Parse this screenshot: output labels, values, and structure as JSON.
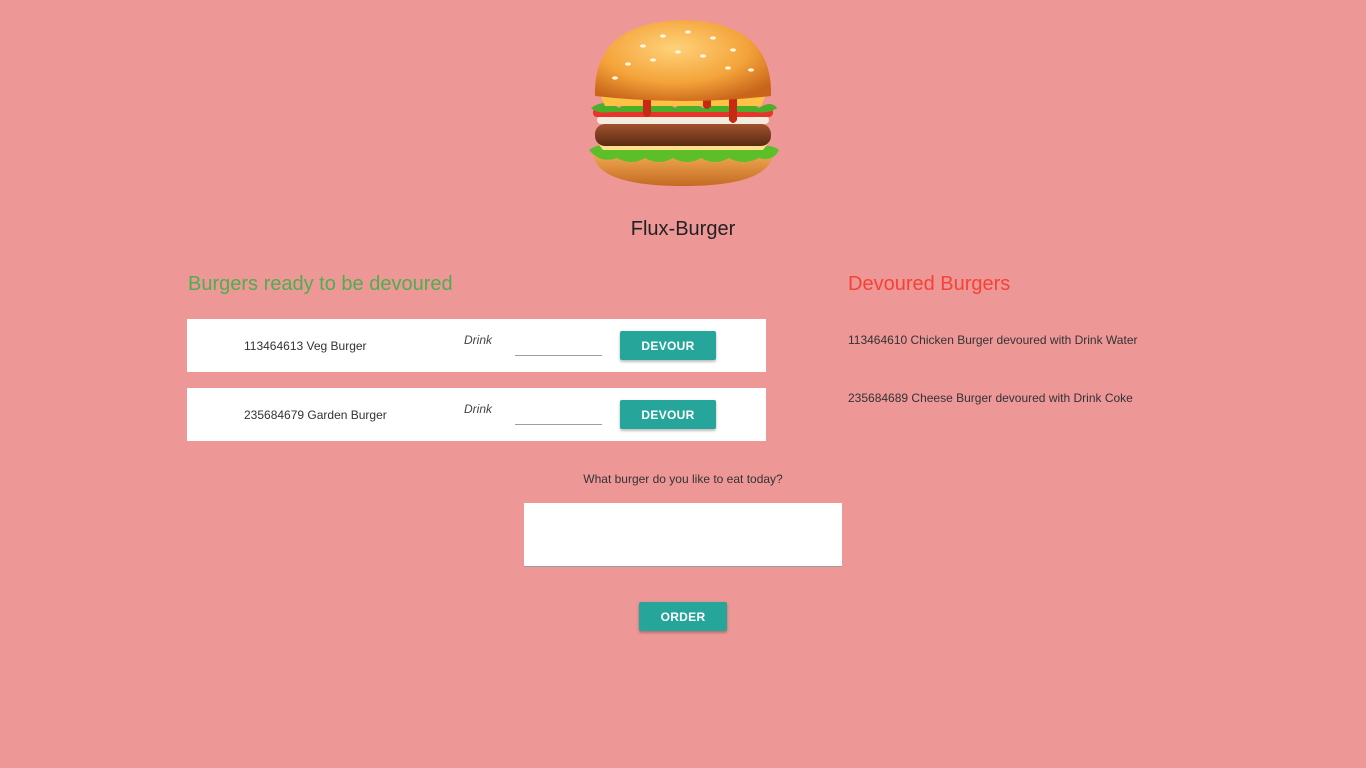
{
  "header": {
    "logo_icon": "burger-icon",
    "title": "Flux-Burger"
  },
  "ready_section": {
    "heading": "Burgers ready to be devoured",
    "heading_color": "#4caf50",
    "items": [
      {
        "name": "113464613 Veg Burger",
        "drink_label": "Drink",
        "drink_value": "",
        "button_label": "DEVOUR"
      },
      {
        "name": "235684679 Garden Burger",
        "drink_label": "Drink",
        "drink_value": "",
        "button_label": "DEVOUR"
      }
    ]
  },
  "devoured_section": {
    "heading": "Devoured Burgers",
    "heading_color": "#f44336",
    "items": [
      "113464610 Chicken Burger devoured with Drink Water",
      "235684689 Cheese Burger devoured with Drink Coke"
    ]
  },
  "order": {
    "prompt": "What burger do you like to eat today?",
    "textarea_value": "",
    "button_label": "ORDER"
  },
  "colors": {
    "background": "#ee9797",
    "button": "#26a69a"
  }
}
